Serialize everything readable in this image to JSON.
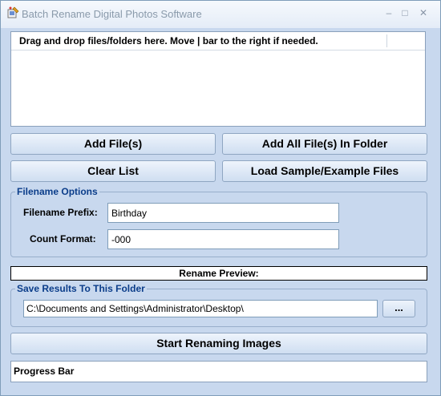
{
  "window": {
    "title": "Batch Rename Digital Photos Software",
    "controls": {
      "minimize": "–",
      "maximize": "□",
      "close": "✕"
    }
  },
  "file_list": {
    "header": "Drag and drop files/folders here. Move | bar to the right if needed."
  },
  "buttons": {
    "add_files": "Add File(s)",
    "add_folder": "Add All File(s) In Folder",
    "clear_list": "Clear List",
    "load_sample": "Load Sample/Example Files",
    "browse": "...",
    "start": "Start Renaming Images"
  },
  "filename_options": {
    "legend": "Filename Options",
    "prefix_label": "Filename Prefix:",
    "prefix_value": "Birthday",
    "count_label": "Count Format:",
    "count_value": "-000"
  },
  "rename_preview": "Rename Preview:",
  "save_folder": {
    "legend": "Save Results To This Folder",
    "path": "C:\\Documents and Settings\\Administrator\\Desktop\\"
  },
  "progress": {
    "label": "Progress Bar"
  },
  "icons": {
    "app": "app-icon",
    "close": "close-icon",
    "minimize": "minimize-icon",
    "maximize": "maximize-icon"
  }
}
